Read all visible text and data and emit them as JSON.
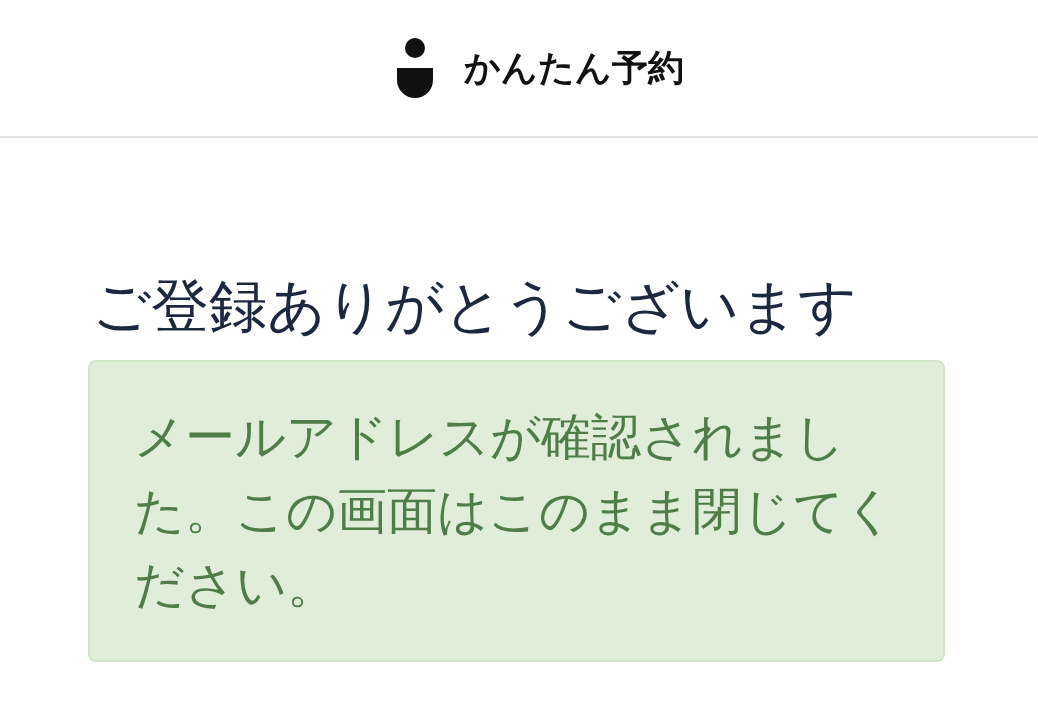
{
  "header": {
    "title": "かんたん予約"
  },
  "heading": "ご登録ありがとうございます",
  "alert": {
    "message": "メールアドレスが確認されました。この画面はこのまま閉じてください。"
  }
}
